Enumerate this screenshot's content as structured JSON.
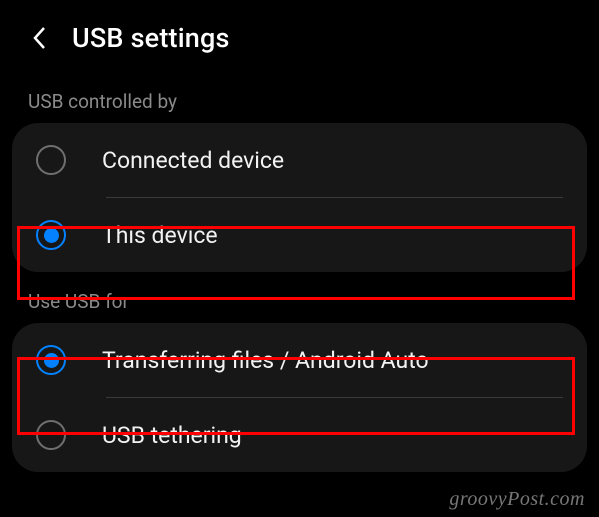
{
  "header": {
    "title": "USB settings"
  },
  "sections": {
    "controlled_by": {
      "label": "USB controlled by",
      "options": {
        "connected_device": "Connected device",
        "this_device": "This device"
      }
    },
    "use_for": {
      "label": "Use USB for",
      "options": {
        "transferring": "Transferring files / Android Auto",
        "tethering": "USB tethering"
      }
    }
  },
  "watermark": "groovyPost.com"
}
